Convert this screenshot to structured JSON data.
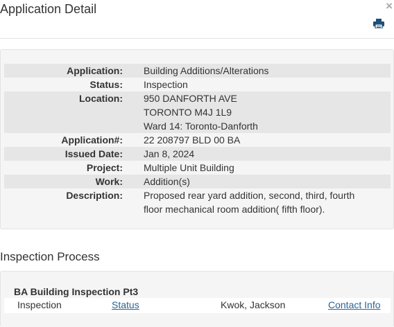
{
  "dialog": {
    "title": "Application Detail",
    "close_glyph": "×",
    "print_icon": "print-icon"
  },
  "details": {
    "application": {
      "label": "Application:",
      "value": "Building Additions/Alterations"
    },
    "status": {
      "label": "Status:",
      "value": "Inspection"
    },
    "location": {
      "label": "Location:",
      "line1": "950 DANFORTH AVE",
      "line2": "TORONTO M4J 1L9",
      "line3": "Ward 14: Toronto-Danforth"
    },
    "application_number": {
      "label": "Application#:",
      "value": "22 208797 BLD 00 BA"
    },
    "issued_date": {
      "label": "Issued Date:",
      "value": "Jan 8, 2024"
    },
    "project": {
      "label": "Project:",
      "value": "Multiple Unit Building"
    },
    "work": {
      "label": "Work:",
      "value": "Addition(s)"
    },
    "description": {
      "label": "Description:",
      "line1": "Proposed rear yard addition, second, third, fourth",
      "line2": "floor mechanical room addition( fifth floor)."
    }
  },
  "inspection": {
    "section_title": "Inspection Process",
    "group_title": "BA Building Inspection Pt3",
    "row": {
      "type": "Inspection",
      "status_link": "Status",
      "inspector": "Kwok, Jackson",
      "contact_link": "Contact Info"
    }
  },
  "colors": {
    "link": "#2a6496",
    "panel_bg": "#f5f5f5",
    "row_shade": "#e6e6e6",
    "print_icon": "#1f4e7a"
  }
}
